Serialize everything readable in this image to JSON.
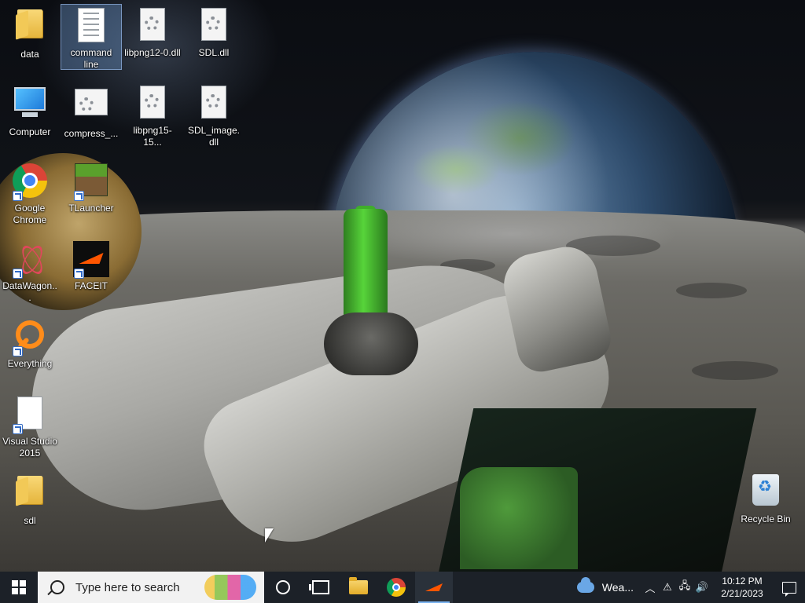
{
  "desktop": {
    "icons": [
      {
        "label": "data",
        "type": "folder"
      },
      {
        "label": "command line",
        "type": "document",
        "selected": true
      },
      {
        "label": "libpng12-0.dll",
        "type": "dll"
      },
      {
        "label": "SDL.dll",
        "type": "dll"
      },
      {
        "label": "Computer",
        "type": "computer"
      },
      {
        "label": "compress_...",
        "type": "dll"
      },
      {
        "label": "libpng15-15...",
        "type": "dll"
      },
      {
        "label": "SDL_image.dll",
        "type": "dll"
      },
      {
        "label": "Google Chrome",
        "type": "chrome-shortcut"
      },
      {
        "label": "TLauncher",
        "type": "tlauncher-shortcut"
      },
      {
        "label": "DataWagon...",
        "type": "datawagon-shortcut"
      },
      {
        "label": "FACEIT",
        "type": "faceit-shortcut"
      },
      {
        "label": "Everything",
        "type": "everything-shortcut"
      },
      {
        "label": "Visual Studio 2015",
        "type": "document-shortcut"
      },
      {
        "label": "sdl",
        "type": "folder"
      },
      {
        "label": "Recycle Bin",
        "type": "recycle-bin"
      }
    ]
  },
  "taskbar": {
    "search_placeholder": "Type here to search",
    "pinned": [
      {
        "name": "cortana",
        "icon": "cortana-circle-icon"
      },
      {
        "name": "task-view",
        "icon": "task-view-icon"
      },
      {
        "name": "file-explorer",
        "icon": "folder-icon"
      },
      {
        "name": "google-chrome",
        "icon": "chrome-icon"
      },
      {
        "name": "faceit",
        "icon": "faceit-icon",
        "active": true
      }
    ],
    "tray": {
      "weather_label": "Wea...",
      "time": "10:12 PM",
      "date": "2/21/2023"
    }
  },
  "colors": {
    "taskbar_bg": "#1c2128",
    "active_indicator": "#7ab3f0",
    "faceit_orange": "#ff5500"
  }
}
